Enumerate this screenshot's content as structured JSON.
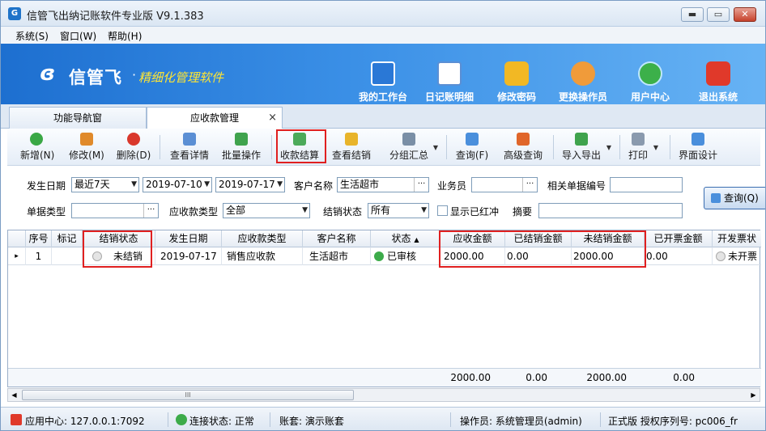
{
  "window": {
    "title": "信管飞出纳记账软件专业版 V9.1.383",
    "min": "▬",
    "max": "▭",
    "close": "✕"
  },
  "menu": [
    {
      "label": "系统(S)"
    },
    {
      "label": "窗口(W)"
    },
    {
      "label": "帮助(H)"
    }
  ],
  "banner": {
    "logo": "信管飞",
    "dot": "·",
    "slogan": "精细化管理软件",
    "nav": [
      {
        "label": "我的工作台",
        "icon": "monitor-icon",
        "color": "#2a78d6"
      },
      {
        "label": "日记账明细",
        "icon": "ledger-icon",
        "color": "#5b8fd4"
      },
      {
        "label": "修改密码",
        "icon": "lock-icon",
        "color": "#f2b824"
      },
      {
        "label": "更换操作员",
        "icon": "user-icon",
        "color": "#f09b3a"
      },
      {
        "label": "用户中心",
        "icon": "globe-icon",
        "color": "#3cb04a"
      },
      {
        "label": "退出系统",
        "icon": "power-icon",
        "color": "#e0392a"
      }
    ]
  },
  "tabs": [
    {
      "label": "功能导航窗"
    },
    {
      "label": "应收款管理",
      "close": "×"
    }
  ],
  "toolbar": [
    {
      "label": "新增(N)",
      "icon": "add-icon",
      "color": "#3aa845"
    },
    {
      "label": "修改(M)",
      "icon": "edit-icon",
      "color": "#e08a2a"
    },
    {
      "label": "删除(D)",
      "icon": "delete-icon",
      "color": "#d9382c"
    },
    {
      "label": "查看详情",
      "icon": "details-icon",
      "color": "#5b8fd4"
    },
    {
      "label": "批量操作",
      "icon": "batch-icon",
      "color": "#3fa34d"
    },
    {
      "label": "收款结算",
      "icon": "settle-icon",
      "color": "#4caa5a"
    },
    {
      "label": "查看结销",
      "icon": "view-settle-icon",
      "color": "#e8b42a"
    },
    {
      "label": "分组汇总",
      "icon": "group-icon",
      "color": "#7a8fa6",
      "arrow": "▼"
    },
    {
      "label": "查询(F)",
      "icon": "search-icon",
      "color": "#4a8fdc"
    },
    {
      "label": "高级查询",
      "icon": "advanced-search-icon",
      "color": "#e0662a"
    },
    {
      "label": "导入导出",
      "icon": "import-export-icon",
      "color": "#3fa34d",
      "arrow": "▼"
    },
    {
      "label": "打印",
      "icon": "print-icon",
      "color": "#8a9aae",
      "arrow": "▼"
    },
    {
      "label": "界面设计",
      "icon": "layout-icon",
      "color": "#4a8fdc"
    }
  ],
  "filters": {
    "date_label": "发生日期",
    "date_range": "最近7天",
    "date_from": "2019-07-10",
    "date_to": "2019-07-17",
    "customer_label": "客户名称",
    "customer": "生活超市",
    "salesman_label": "业务员",
    "salesman": "",
    "ref_label": "相关单据编号",
    "ref": "",
    "doctype_label": "单据类型",
    "doctype": "",
    "rtype_label": "应收款类型",
    "rtype": "全部",
    "status_label": "结销状态",
    "status": "所有",
    "show_red_label": "显示已红冲",
    "summary_label": "摘要",
    "summary": "",
    "query_button": "查询(Q)",
    "dots": "···",
    "dd": "▼"
  },
  "grid": {
    "headers": [
      "序号",
      "标记",
      "结销状态",
      "发生日期",
      "应收款类型",
      "客户名称",
      "状态",
      "应收金额",
      "已结销金额",
      "未结销金额",
      "已开票金额",
      "开发票状"
    ],
    "sort_arrow": "▲",
    "rows": [
      {
        "pointer": "▸",
        "no": "1",
        "mark": "",
        "settle_status": "未结销",
        "date": "2019-07-17",
        "type": "销售应收款",
        "customer": "生活超市",
        "state": "已审核",
        "amount": "2000.00",
        "settled": "0.00",
        "unsettled": "2000.00",
        "invoiced": "0.00",
        "invoice_state": "未开票"
      }
    ],
    "totals": {
      "amount": "2000.00",
      "settled": "0.00",
      "unsettled": "2000.00",
      "invoiced": "0.00"
    }
  },
  "scroll": {
    "left": "◀",
    "right": "▶",
    "grip": "III"
  },
  "status": {
    "app_center": "应用中心: 127.0.0.1:7092",
    "connection": "连接状态: 正常",
    "account": "账套: 演示账套",
    "operator": "操作员: 系统管理员(admin)",
    "license": "正式版 授权序列号: pc006_fr"
  },
  "colors": {
    "banner": "#2a7fdc",
    "highlight": "#e02020",
    "slogan": "#ffe533"
  }
}
